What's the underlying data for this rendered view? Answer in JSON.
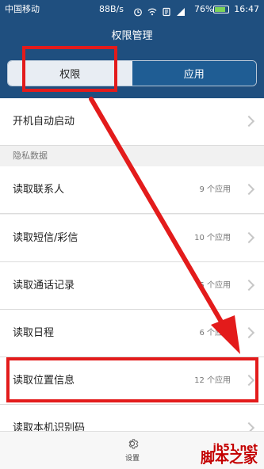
{
  "status_bar": {
    "carrier": "中国移动",
    "net_speed": "88B/s",
    "battery_percent": "76%",
    "time": "16:47"
  },
  "header": {
    "title": "权限管理",
    "tabs": [
      {
        "label": "权限",
        "selected": true
      },
      {
        "label": "应用",
        "selected": false
      }
    ]
  },
  "list": {
    "auto_start_label": "开机自动启动",
    "privacy_section_label": "隐私数据",
    "items": [
      {
        "label": "读取联系人",
        "count": "9 个应用"
      },
      {
        "label": "读取短信/彩信",
        "count": "10 个应用"
      },
      {
        "label": "读取通话记录",
        "count": "5 个应用"
      },
      {
        "label": "读取日程",
        "count": "6 个应用"
      },
      {
        "label": "读取位置信息",
        "count": "12 个应用"
      },
      {
        "label": "读取本机识别码",
        "count": ""
      }
    ]
  },
  "bottom_bar": {
    "settings_label": "设置",
    "settings_icon": "gear-icon"
  },
  "watermark": {
    "site": "jb51.net",
    "name": "脚本之家"
  },
  "colors": {
    "header_bg": "#1f4f7f",
    "annotation_red": "#e31b1b"
  }
}
